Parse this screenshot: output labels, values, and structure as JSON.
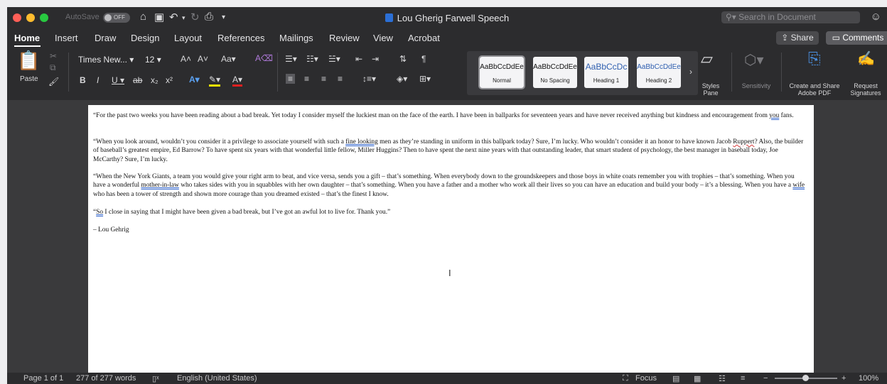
{
  "window": {
    "autosave_label": "AutoSave",
    "autosave_state": "OFF",
    "title": "Lou Gherig Farwell Speech",
    "search_placeholder": "Search in Document"
  },
  "tabs": [
    "Home",
    "Insert",
    "Draw",
    "Design",
    "Layout",
    "References",
    "Mailings",
    "Review",
    "View",
    "Acrobat"
  ],
  "header_buttons": {
    "share": "Share",
    "comments": "Comments"
  },
  "ribbon": {
    "paste": "Paste",
    "font_name": "Times New...",
    "font_size": "12",
    "styles": [
      {
        "sample": "AaBbCcDdEe",
        "name": "Normal"
      },
      {
        "sample": "AaBbCcDdEe",
        "name": "No Spacing"
      },
      {
        "sample": "AaBbCcDc",
        "name": "Heading 1"
      },
      {
        "sample": "AaBbCcDdEe",
        "name": "Heading 2"
      }
    ],
    "styles_pane": "Styles Pane",
    "sensitivity": "Sensitivity",
    "create_pdf": "Create and Share Adobe PDF",
    "request_signatures": "Request Signatures"
  },
  "document": {
    "p1": {
      "a": "“For the past two weeks you have been reading about a bad break. Yet today I consider myself the luckiest man on the face of the earth. I have been in ballparks for seventeen years and have never received anything but kindness and encouragement from ",
      "b": "you",
      "c": " fans."
    },
    "p2": {
      "a": "“When you look around, wouldn’t you consider it a privilege to associate yourself with such a ",
      "b": "fine looking",
      "c": " men as they’re standing in uniform in this ballpark today? Sure, I’m lucky. Who wouldn’t consider it an honor to have known Jacob ",
      "d": "Ruppert",
      "e": "? Also, the builder of baseball’s greatest empire, Ed Barrow? To have spent six years with that wonderful little fellow, Miller Huggins? Then to have spent the next nine years with that outstanding leader, that smart student of psychology, the best manager in baseball today, Joe McCarthy? Sure, I’m lucky."
    },
    "p3": {
      "a": "“When the New York Giants, a team you would give your right arm to beat, and vice versa, sends you a gift – that’s something. When everybody down to the groundskeepers and those boys in white coats remember you with trophies – that’s something. When you have a wonderful ",
      "b": "mother-in-law",
      "c": " who takes sides with you in squabbles with her own daughter – that’s something. When you have a father and a mother who work all their lives so you can have an education and build your body – it’s a blessing. When you have a ",
      "d": "wife",
      "e": " who has been a tower of strength and shown more courage than you dreamed existed – that’s the finest I know."
    },
    "p4": {
      "a": "“",
      "b": "So",
      "c": " I close in saying that I might have been given a bad break, but I’ve got an awful lot to live for. Thank you.”"
    },
    "p5": "– Lou Gehrig"
  },
  "status": {
    "page": "Page 1 of 1",
    "words": "277 of 277 words",
    "language": "English (United States)",
    "focus": "Focus",
    "zoom": "100%"
  }
}
